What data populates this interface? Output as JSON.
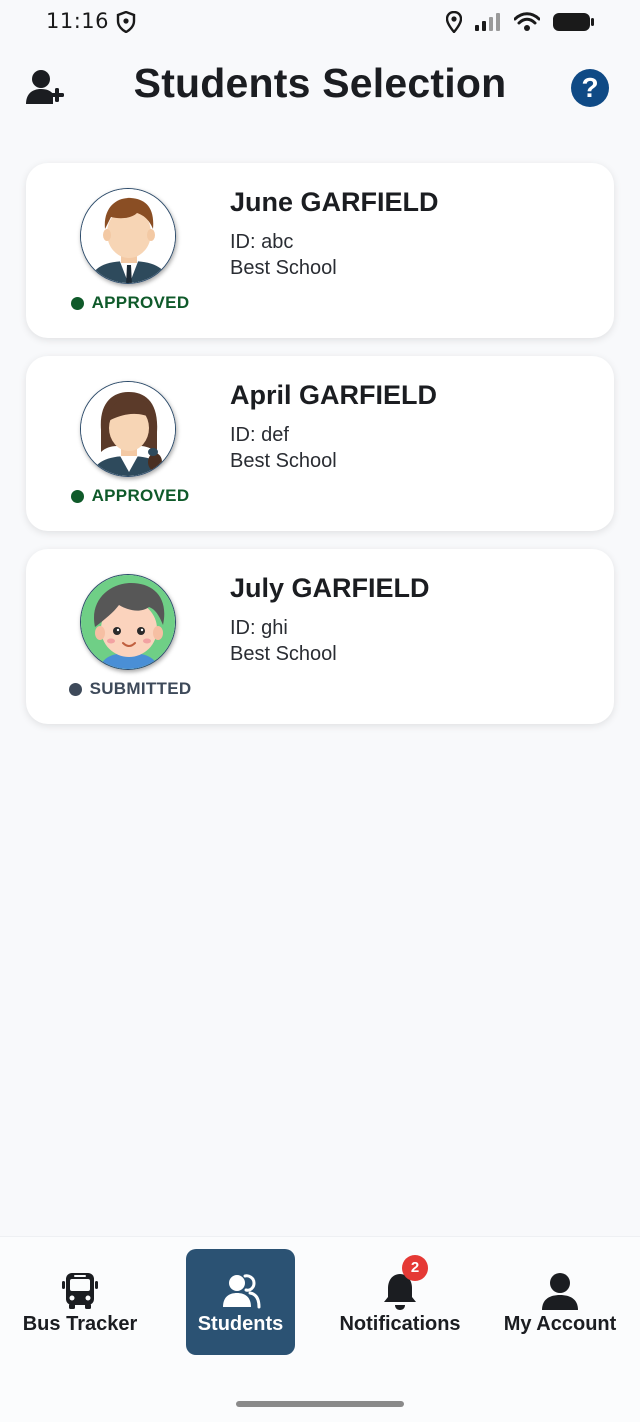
{
  "status_bar": {
    "time": "11:16",
    "icons": [
      "shield-icon",
      "location-icon",
      "signal-icon",
      "wifi-icon",
      "battery-icon"
    ]
  },
  "header": {
    "title": "Students Selection",
    "left_icon": "add-user-icon",
    "right_icon": "help-icon",
    "help_symbol": "?",
    "help_color": "#0f4a85"
  },
  "students": [
    {
      "name": "June GARFIELD",
      "id": "ID: abc",
      "school": "Best School",
      "status": "APPROVED",
      "status_color": "#0f5a2a",
      "avatar": "boy-in-uniform-avatar"
    },
    {
      "name": "April GARFIELD",
      "id": "ID: def",
      "school": "Best School",
      "status": "APPROVED",
      "status_color": "#0f5a2a",
      "avatar": "girl-with-braid-avatar"
    },
    {
      "name": "July GARFIELD",
      "id": "ID: ghi",
      "school": "Best School",
      "status": "SUBMITTED",
      "status_color": "#3e4a5a",
      "avatar": "kid-on-green-avatar"
    }
  ],
  "nav": {
    "active_color": "#2b5273",
    "items": [
      {
        "label": "Bus Tracker",
        "icon": "bus-icon"
      },
      {
        "label": "Students",
        "icon": "students-icon"
      },
      {
        "label": "Notifications",
        "icon": "bell-icon",
        "badge": "2"
      },
      {
        "label": "My Account",
        "icon": "account-icon"
      }
    ]
  }
}
